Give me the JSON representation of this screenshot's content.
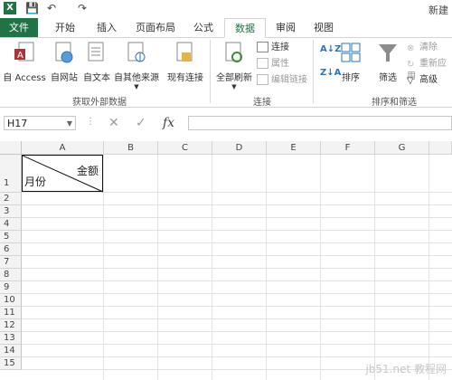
{
  "title": "新建",
  "quick_access": [
    "💾",
    "↶",
    "↷"
  ],
  "tabs": [
    "文件",
    "开始",
    "插入",
    "页面布局",
    "公式",
    "数据",
    "审阅",
    "视图"
  ],
  "active_tab": "数据",
  "ribbon": {
    "get_external": {
      "buttons": [
        "自 Access",
        "自网站",
        "自文本",
        "自其他来源"
      ],
      "existing": "现有连接",
      "label": "获取外部数据"
    },
    "connections": {
      "refresh_all": "全部刷新",
      "connect": "连接",
      "properties": "属性",
      "edit_links": "编辑链接",
      "label": "连接"
    },
    "sort_filter": {
      "sort": "排序",
      "filter": "筛选",
      "clear": "清除",
      "reapply": "重新应用",
      "advanced": "高级",
      "label": "排序和筛选"
    }
  },
  "formula_bar": {
    "name_box": "H17",
    "fx": "fx",
    "formula": ""
  },
  "grid": {
    "columns": [
      "A",
      "B",
      "C",
      "D",
      "E",
      "F",
      "G"
    ],
    "rows": [
      "1",
      "2",
      "3",
      "4",
      "5",
      "6",
      "7",
      "8",
      "9",
      "10",
      "11",
      "12",
      "13",
      "14",
      "15"
    ],
    "a1_amount": "金额",
    "a1_month": "月份"
  },
  "watermark": "jb51.net 教程网"
}
